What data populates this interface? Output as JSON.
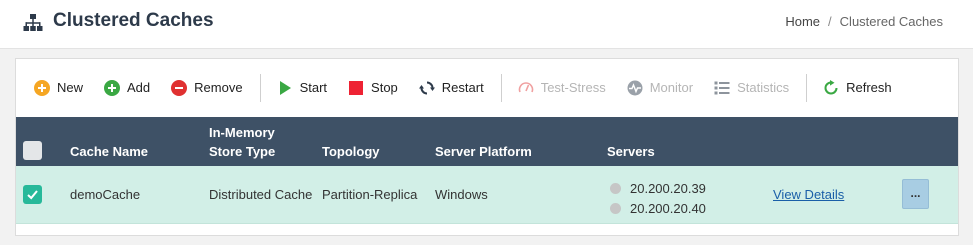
{
  "header": {
    "title": "Clustered Caches",
    "title_icon": "sitemap-icon",
    "breadcrumb": {
      "home": "Home",
      "separator": "/",
      "current": "Clustered Caches"
    }
  },
  "toolbar": {
    "new": "New",
    "add": "Add",
    "remove": "Remove",
    "start": "Start",
    "stop": "Stop",
    "restart": "Restart",
    "test_stress": "Test-Stress",
    "monitor": "Monitor",
    "statistics": "Statistics",
    "refresh": "Refresh"
  },
  "table": {
    "columns": {
      "cache_name": "Cache Name",
      "store_type_1": "In-Memory",
      "store_type_2": "Store Type",
      "topology": "Topology",
      "platform": "Server Platform",
      "servers": "Servers"
    },
    "rows": [
      {
        "checked": true,
        "cache_name": "demoCache",
        "store_type": "Distributed Cache",
        "topology": "Partition-Replica",
        "platform": "Windows",
        "servers": [
          "20.200.20.39",
          "20.200.20.40"
        ],
        "details": "View Details",
        "more": "..."
      }
    ]
  },
  "colors": {
    "header_bg": "#3e5166",
    "row_selected_bg": "#d2efe7",
    "checkbox_checked": "#27b99a",
    "new_icon": "#f5a623",
    "add_icon": "#3aa843",
    "remove_icon": "#e03131",
    "start_icon": "#3aa843",
    "stop_icon": "#ee2233",
    "refresh_icon": "#3aa843"
  }
}
